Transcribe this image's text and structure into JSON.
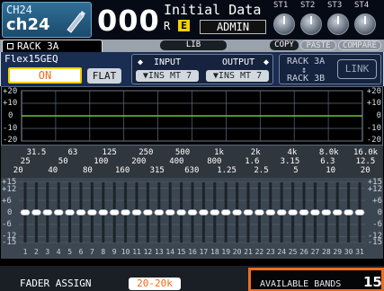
{
  "header": {
    "channel_number": "CH24",
    "channel_name": "ch24",
    "scene_number": "000",
    "scene_title": "Initial Data",
    "scene_r": "R",
    "scene_e": "E",
    "user": "ADMIN",
    "st_labels": [
      "ST1",
      "ST2",
      "ST3",
      "ST4"
    ]
  },
  "tabs": {
    "rack": "RACK 3A",
    "lib": "LIB",
    "copy": "COPY",
    "paste": "PASTE",
    "compare": "COMPARE"
  },
  "controls": {
    "module": "Flex15GEQ",
    "on": "ON",
    "flat": "FLAT",
    "input_label": "INPUT",
    "output_label": "OUTPUT",
    "input_value": "INS MT 7",
    "output_value": "INS MT 7",
    "rack_a": "RACK 3A",
    "rack_b": "RACK 3B",
    "link": "LINK"
  },
  "graph": {
    "db_labels": [
      "+20",
      "+10",
      "0",
      "-10",
      "-20"
    ]
  },
  "frequencies": {
    "row1": [
      "31.5",
      "63",
      "125",
      "250",
      "500",
      "1k",
      "2k",
      "4k",
      "8.0k",
      "16.0k"
    ],
    "row2": [
      "25",
      "50",
      "100",
      "200",
      "400",
      "800",
      "1.6",
      "3.15",
      "6.3",
      "12.5"
    ],
    "row3": [
      "20",
      "40",
      "80",
      "160",
      "315",
      "630",
      "1.25",
      "2.5",
      "5",
      "10",
      "20"
    ]
  },
  "faders": {
    "scale": [
      "+15",
      "+12",
      "+6",
      "0",
      "-6",
      "-12",
      "-15"
    ],
    "band_numbers": [
      "1",
      "2",
      "3",
      "4",
      "5",
      "6",
      "7",
      "8",
      "9",
      "10",
      "11",
      "12",
      "13",
      "14",
      "15",
      "16",
      "17",
      "18",
      "19",
      "20",
      "21",
      "22",
      "23",
      "24",
      "25",
      "26",
      "27",
      "28",
      "29",
      "30",
      "31"
    ],
    "gain_db": [
      0,
      0,
      0,
      0,
      0,
      0,
      0,
      0,
      0,
      0,
      0,
      0,
      0,
      0,
      0,
      0,
      0,
      0,
      0,
      0,
      0,
      0,
      0,
      0,
      0,
      0,
      0,
      0,
      0,
      0,
      0
    ]
  },
  "bottom": {
    "fader_assign": "FADER ASSIGN",
    "fader_range": "20-20k",
    "available_bands_label": "AVAILABLE BANDS",
    "available_bands_value": "15"
  },
  "colors": {
    "on_text": "#f26b1d",
    "on_border": "#f6d000",
    "highlight": "#f26b1d",
    "curve": "#6fbf3f"
  }
}
